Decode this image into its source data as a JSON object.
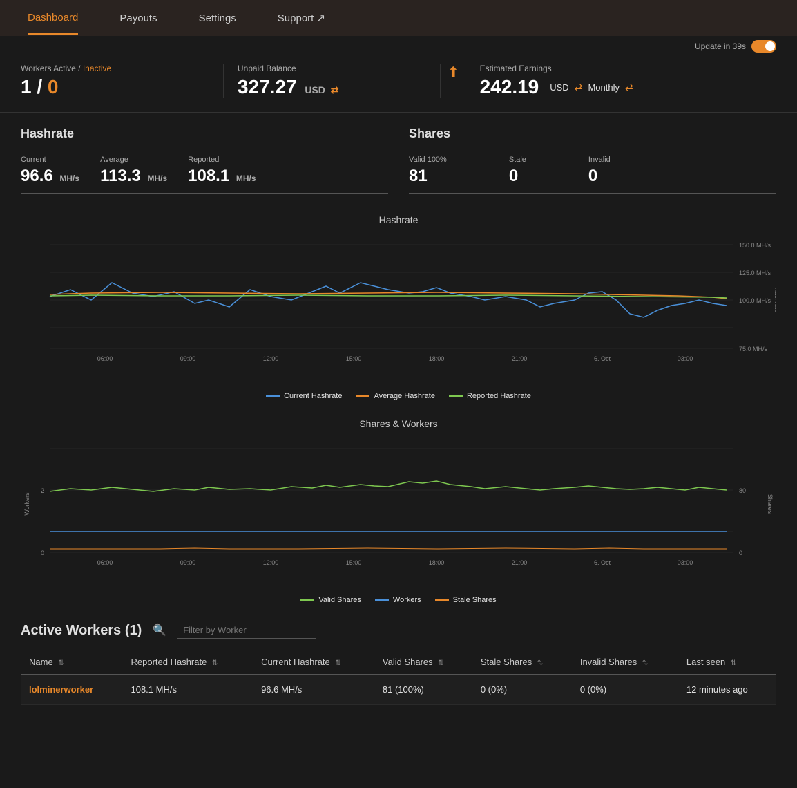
{
  "nav": {
    "items": [
      {
        "label": "Dashboard",
        "active": true
      },
      {
        "label": "Payouts",
        "active": false
      },
      {
        "label": "Settings",
        "active": false
      },
      {
        "label": "Support ↗",
        "active": false
      }
    ]
  },
  "update": {
    "text": "Update in 39s",
    "enabled": true
  },
  "stats": {
    "workers": {
      "label": "Workers Active / Inactive",
      "active": "1",
      "separator": " / ",
      "inactive": "0"
    },
    "unpaid": {
      "label": "Unpaid Balance",
      "value": "327.27",
      "currency": "USD"
    },
    "estimated": {
      "label": "Estimated Earnings",
      "value": "242.19",
      "currency": "USD",
      "period": "Monthly"
    }
  },
  "hashrate": {
    "title": "Hashrate",
    "current": {
      "label": "Current",
      "value": "96.6",
      "unit": "MH/s"
    },
    "average": {
      "label": "Average",
      "value": "113.3",
      "unit": "MH/s"
    },
    "reported": {
      "label": "Reported",
      "value": "108.1",
      "unit": "MH/s"
    }
  },
  "shares": {
    "title": "Shares",
    "valid": {
      "label": "Valid 100%",
      "value": "81"
    },
    "stale": {
      "label": "Stale",
      "value": "0"
    },
    "invalid": {
      "label": "Invalid",
      "value": "0"
    }
  },
  "hashrate_chart": {
    "title": "Hashrate",
    "y_labels": [
      "150.0 MH/s",
      "125.0 MH/s",
      "100.0 MH/s",
      "75.0 MH/s"
    ],
    "x_labels": [
      "06:00",
      "09:00",
      "12:00",
      "15:00",
      "18:00",
      "21:00",
      "6. Oct",
      "03:00"
    ],
    "y_axis_label": "Hashrate",
    "legend": [
      {
        "label": "Current Hashrate",
        "color": "#4a90d9"
      },
      {
        "label": "Average Hashrate",
        "color": "#e8882a"
      },
      {
        "label": "Reported Hashrate",
        "color": "#7ec850"
      }
    ]
  },
  "shares_chart": {
    "title": "Shares & Workers",
    "y_left_labels": [
      "2",
      "0"
    ],
    "y_right_labels": [
      "80",
      "0"
    ],
    "x_labels": [
      "06:00",
      "09:00",
      "12:00",
      "15:00",
      "18:00",
      "21:00",
      "6. Oct",
      "03:00"
    ],
    "left_axis_label": "Workers",
    "right_axis_label": "Shares",
    "legend": [
      {
        "label": "Valid Shares",
        "color": "#7ec850"
      },
      {
        "label": "Workers",
        "color": "#4a90d9"
      },
      {
        "label": "Stale Shares",
        "color": "#e8882a"
      }
    ]
  },
  "active_workers": {
    "title": "Active Workers",
    "count": "(1)",
    "filter_placeholder": "Filter by Worker",
    "columns": [
      {
        "label": "Name",
        "sortable": true
      },
      {
        "label": "Reported Hashrate",
        "sortable": true
      },
      {
        "label": "Current Hashrate",
        "sortable": true
      },
      {
        "label": "Valid Shares",
        "sortable": true
      },
      {
        "label": "Stale Shares",
        "sortable": true
      },
      {
        "label": "Invalid Shares",
        "sortable": true
      },
      {
        "label": "Last seen",
        "sortable": true
      }
    ],
    "rows": [
      {
        "name": "lolminerworker",
        "reported_hashrate": "108.1 MH/s",
        "current_hashrate": "96.6 MH/s",
        "valid_shares": "81 (100%)",
        "stale_shares": "0 (0%)",
        "invalid_shares": "0 (0%)",
        "last_seen": "12 minutes ago"
      }
    ]
  }
}
